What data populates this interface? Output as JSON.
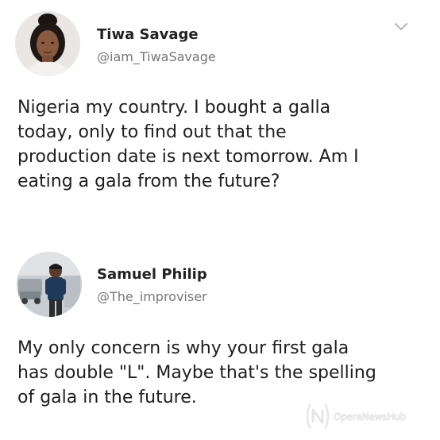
{
  "tweets": [
    {
      "display_name": "Tiwa Savage",
      "handle": "@iam_TiwaSavage",
      "text": "Nigeria my country. I bought a galla\ntoday, only to find out that the\nproduction date is next tomorrow. Am I\neating a gala from the future?"
    },
    {
      "display_name": "Samuel Philip",
      "handle": "@The_improviser",
      "text": "My only concern is why your first gala\nhas double \"L\". Maybe that's the spelling\nof gala in the future."
    }
  ],
  "icons": {
    "menu": "chevron-down-icon",
    "watermark_logo": "operanews-logo-icon"
  },
  "watermark": {
    "text": "OperaNewsHub"
  },
  "colors": {
    "background": "#ffffff",
    "name": "#222222",
    "handle": "#777777",
    "text": "#1e1e1e"
  }
}
